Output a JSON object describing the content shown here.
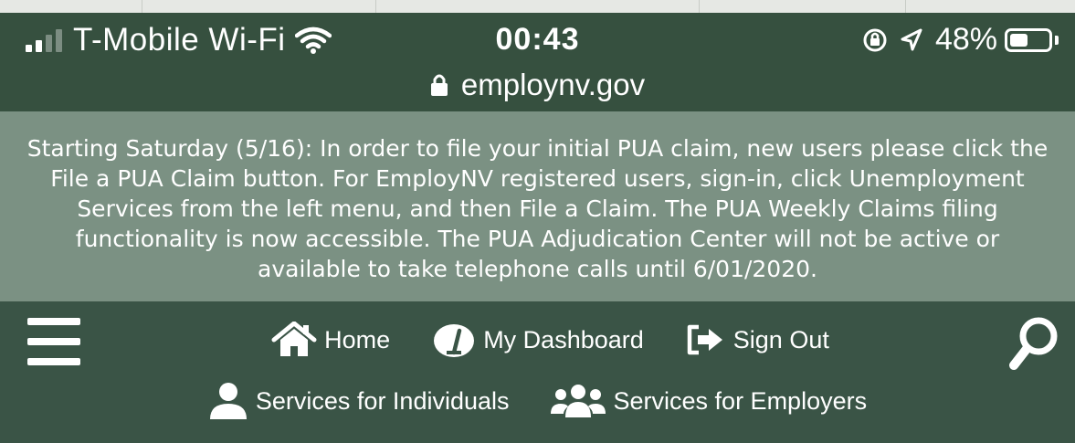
{
  "status_bar": {
    "carrier": "T-Mobile Wi-Fi",
    "time": "00:43",
    "battery": "48%",
    "battery_level": 0.48,
    "url": "employnv.gov"
  },
  "notice": {
    "text": "Starting Saturday (5/16): In order to file your initial PUA claim, new users please click the File a PUA Claim button. For EmployNV registered users, sign-in, click Unemployment Services from the left menu, and then File a Claim. The PUA Weekly Claims filing functionality is now accessible. The PUA Adjudication Center will not be active or available to take telephone calls until 6/01/2020."
  },
  "nav": {
    "home": "Home",
    "dashboard": "My Dashboard",
    "sign_out": "Sign Out",
    "individuals": "Services for Individuals",
    "employers": "Services for Employers"
  },
  "icons": {
    "menu": "hamburger-menu-icon",
    "search": "search-icon",
    "home": "home-icon",
    "dashboard": "gauge-icon",
    "sign_out": "sign-out-icon",
    "individuals": "user-icon",
    "employers": "users-icon"
  },
  "colors": {
    "header_bg": "#36503f",
    "notice_bg": "#7b9183",
    "nav_bg": "#3a5446",
    "text": "#ffffff"
  }
}
